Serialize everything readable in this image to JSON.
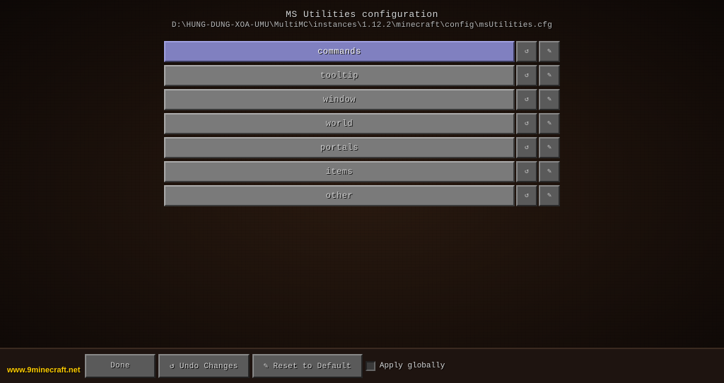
{
  "window": {
    "title": "MS Utilities configuration",
    "path": "D:\\HUNG-DUNG-XOA-UMU\\MultiMC\\instances\\1.12.2\\minecraft\\config\\msUtilities.cfg"
  },
  "menu": {
    "items": [
      {
        "id": "commands",
        "label": "commands",
        "active": true
      },
      {
        "id": "tooltip",
        "label": "tooltip",
        "active": false
      },
      {
        "id": "window",
        "label": "window",
        "active": false
      },
      {
        "id": "world",
        "label": "world",
        "active": false
      },
      {
        "id": "portals",
        "label": "portals",
        "active": false
      },
      {
        "id": "items",
        "label": "items",
        "active": false
      },
      {
        "id": "other",
        "label": "other",
        "active": false
      }
    ],
    "icon_reset": "↺",
    "icon_edit": "✎"
  },
  "bottom_bar": {
    "done_label": "Done",
    "undo_label": "↺ Undo Changes",
    "reset_label": "✎ Reset to Default",
    "apply_label": "Apply globally"
  },
  "watermark": {
    "text": "www.",
    "highlight": "9minecraft",
    "suffix": ".net"
  }
}
